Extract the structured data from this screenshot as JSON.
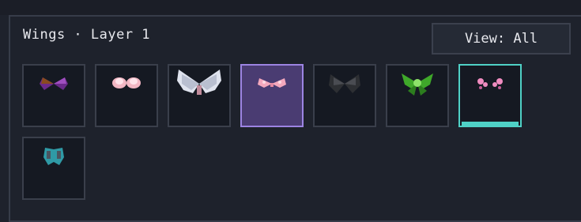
{
  "header": {
    "title": "Wings · Layer 1",
    "view_label": "View: All"
  },
  "wings": [
    {
      "icon": "dark-purple-wings-icon",
      "state": "normal"
    },
    {
      "icon": "pink-feather-wings-icon",
      "state": "normal"
    },
    {
      "icon": "white-angel-wings-icon",
      "state": "normal"
    },
    {
      "icon": "pink-fairy-wings-icon",
      "state": "selected"
    },
    {
      "icon": "black-wings-icon",
      "state": "normal"
    },
    {
      "icon": "green-insect-wings-icon",
      "state": "normal"
    },
    {
      "icon": "pink-butterfly-wings-icon",
      "state": "equipped"
    },
    {
      "icon": "teal-beetle-wings-icon",
      "state": "normal"
    }
  ],
  "colors": {
    "selected": "#4a3c72",
    "selected_border": "#9c84e2",
    "equipped": "#4fd1c6"
  }
}
